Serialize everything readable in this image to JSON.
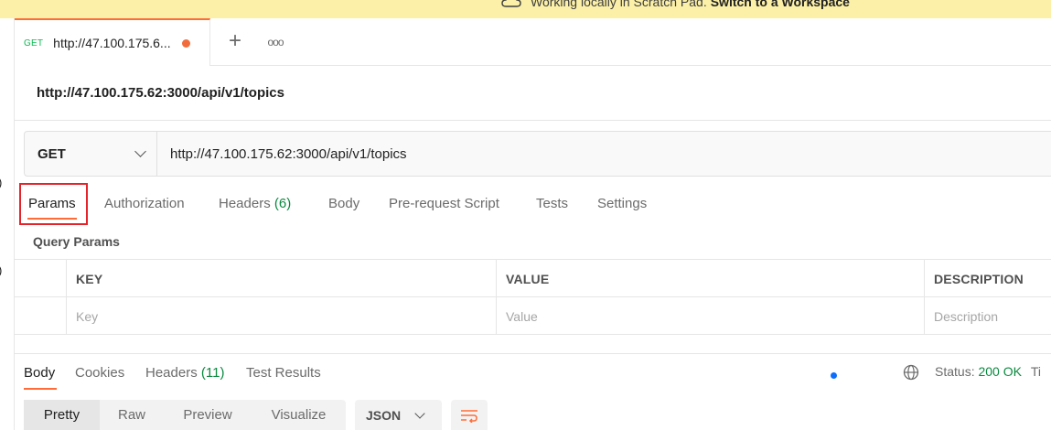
{
  "banner": {
    "text": "Working locally in Scratch Pad.",
    "link": "Switch to a Workspace"
  },
  "tab": {
    "method": "GET",
    "title": "http://47.100.175.6...",
    "add_label": "+",
    "more_label": "ooo"
  },
  "request": {
    "name": "http://47.100.175.62:3000/api/v1/topics",
    "method": "GET",
    "url": "http://47.100.175.62:3000/api/v1/topics"
  },
  "request_tabs": {
    "params": "Params",
    "authorization": "Authorization",
    "headers": "Headers",
    "headers_count": "(6)",
    "body": "Body",
    "pre_request": "Pre-request Script",
    "tests": "Tests",
    "settings": "Settings"
  },
  "query_params": {
    "title": "Query Params",
    "columns": [
      "KEY",
      "VALUE",
      "DESCRIPTION"
    ],
    "placeholders": [
      "Key",
      "Value",
      "Description"
    ]
  },
  "response_tabs": {
    "body": "Body",
    "cookies": "Cookies",
    "headers": "Headers",
    "headers_count": "(11)",
    "test_results": "Test Results"
  },
  "status": {
    "label": "Status:",
    "code": "200 OK",
    "cut": "Ti"
  },
  "view": {
    "pretty": "Pretty",
    "raw": "Raw",
    "preview": "Preview",
    "visualize": "Visualize",
    "format": "JSON"
  },
  "colors": {
    "accent": "#ff6c37",
    "highlight": "#e4232a",
    "banner_bg": "#fcf0a8",
    "success": "#0a8a3f"
  }
}
